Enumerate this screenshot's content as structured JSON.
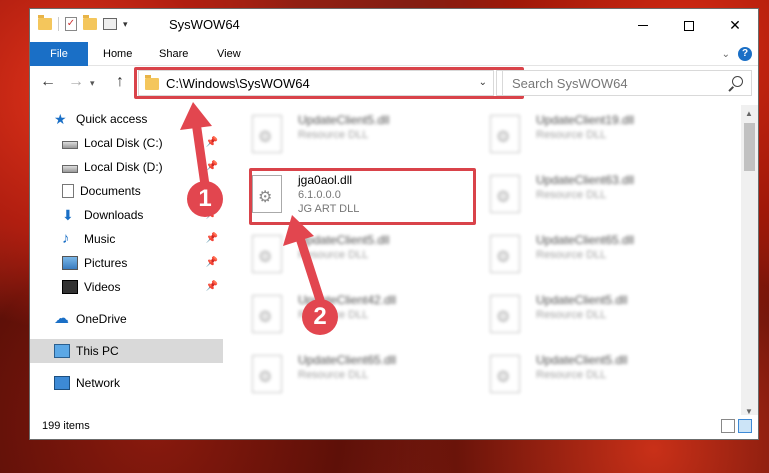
{
  "window": {
    "title": "SysWOW64"
  },
  "ribbon": {
    "tabs": [
      "File",
      "Home",
      "Share",
      "View"
    ]
  },
  "address": {
    "path": "C:\\Windows\\SysWOW64"
  },
  "search": {
    "placeholder": "Search SysWOW64"
  },
  "sidebar": {
    "items": [
      {
        "label": "Quick access",
        "icon": "star-icon"
      },
      {
        "label": "Local Disk (C:)",
        "icon": "drive-icon",
        "pinned": true
      },
      {
        "label": "Local Disk (D:)",
        "icon": "drive-icon",
        "pinned": true
      },
      {
        "label": "Documents",
        "icon": "documents-icon",
        "pinned": true
      },
      {
        "label": "Downloads",
        "icon": "download-icon",
        "pinned": true
      },
      {
        "label": "Music",
        "icon": "music-icon",
        "pinned": true
      },
      {
        "label": "Pictures",
        "icon": "pictures-icon",
        "pinned": true
      },
      {
        "label": "Videos",
        "icon": "videos-icon",
        "pinned": true
      },
      {
        "label": "OneDrive",
        "icon": "cloud-icon"
      },
      {
        "label": "This PC",
        "icon": "computer-icon",
        "selected": true
      },
      {
        "label": "Network",
        "icon": "network-icon"
      }
    ]
  },
  "files": {
    "items": [
      {
        "name": "UpdateClient5.dll",
        "line2": "Resource DLL",
        "line3": "",
        "blurred": true
      },
      {
        "name": "UpdateClient19.dll",
        "line2": "Resource DLL",
        "line3": "",
        "blurred": true
      },
      {
        "name": "jga0aol.dll",
        "line2": "6.1.0.0.0",
        "line3": "JG ART DLL",
        "blurred": false
      },
      {
        "name": "UpdateClient63.dll",
        "line2": "Resource DLL",
        "line3": "",
        "blurred": true
      },
      {
        "name": "UpdateClient5.dll",
        "line2": "Resource DLL",
        "line3": "",
        "blurred": true
      },
      {
        "name": "UpdateClient65.dll",
        "line2": "Resource DLL",
        "line3": "",
        "blurred": true
      },
      {
        "name": "UpdateClient42.dll",
        "line2": "Resource DLL",
        "line3": "",
        "blurred": true
      },
      {
        "name": "UpdateClient5.dll",
        "line2": "Resource DLL",
        "line3": "",
        "blurred": true
      },
      {
        "name": "UpdateClient65.dll",
        "line2": "Resource DLL",
        "line3": "",
        "blurred": true
      },
      {
        "name": "UpdateClient5.dll",
        "line2": "Resource DLL",
        "line3": "",
        "blurred": true
      }
    ]
  },
  "status": {
    "item_count": "199 items"
  },
  "annotations": {
    "badge1": "1",
    "badge2": "2",
    "color": "#e2464f"
  },
  "colors": {
    "accent": "#1a6fc6",
    "highlight": "#d9434a"
  }
}
